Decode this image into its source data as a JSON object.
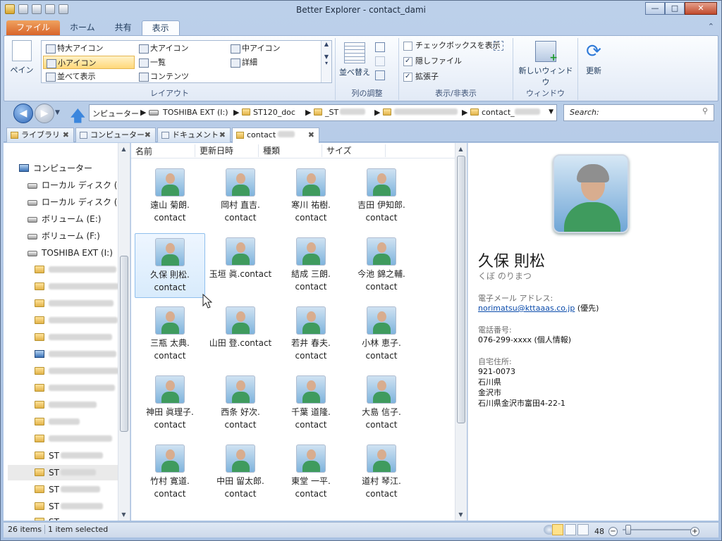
{
  "window": {
    "title": "Better Explorer - contact_dami"
  },
  "ribbon": {
    "tabs": [
      "ファイル",
      "ホーム",
      "共有",
      "表示"
    ],
    "pane_label": "ペイン",
    "layout_items": [
      "特大アイコン",
      "大アイコン",
      "中アイコン",
      "小アイコン",
      "一覧",
      "詳細",
      "並べて表示",
      "コンテンツ"
    ],
    "layout_group": "レイアウト",
    "sort_label": "並べ替え",
    "columns_group": "列の調整",
    "checkbox_label": "チェックボックスを表示",
    "hidden_label": "隠しファイル",
    "ext_label": "拡張子",
    "showhide_group": "表示/非表示",
    "new_window_label": "新しいウィンドウ",
    "window_group": "ウィンドウ",
    "refresh_label": "更新"
  },
  "address": {
    "crumbs": [
      "ンピューター",
      "TOSHIBA EXT (I:)",
      "ST120_doc",
      "_ST",
      "",
      "contact_"
    ],
    "search_placeholder": "Search:"
  },
  "doc_tabs": [
    "ライブラリ",
    "コンピューター",
    "ドキュメント",
    "contact"
  ],
  "nav": {
    "computer": "コンピューター",
    "drives": [
      "ローカル ディスク (",
      "ローカル ディスク (",
      "ボリューム (E:)",
      "ボリューム (F:)",
      "TOSHIBA EXT (I:)"
    ],
    "st_folders": [
      "ST",
      "ST",
      "ST",
      "ST",
      "ST"
    ]
  },
  "columns": [
    "名前",
    "更新日時",
    "種類",
    "サイズ"
  ],
  "files": [
    {
      "line1": "遠山 菊朗.",
      "line2": "contact"
    },
    {
      "line1": "岡村 直吉.",
      "line2": "contact"
    },
    {
      "line1": "寒川 祐樹.",
      "line2": "contact"
    },
    {
      "line1": "吉田 伊知郎.",
      "line2": "contact"
    },
    {
      "line1": "久保 則松.",
      "line2": "contact"
    },
    {
      "line1": "玉垣 眞.contact",
      "line2": ""
    },
    {
      "line1": "結成 三朗.",
      "line2": "contact"
    },
    {
      "line1": "今池 錦之輔.",
      "line2": "contact"
    },
    {
      "line1": "三瓶 太典.",
      "line2": "contact"
    },
    {
      "line1": "山田 登.contact",
      "line2": ""
    },
    {
      "line1": "若井 春夫.",
      "line2": "contact"
    },
    {
      "line1": "小林 恵子.",
      "line2": "contact"
    },
    {
      "line1": "神田 眞理子.",
      "line2": "contact"
    },
    {
      "line1": "西条 好次.",
      "line2": "contact"
    },
    {
      "line1": "千葉 道隆.",
      "line2": "contact"
    },
    {
      "line1": "大島 信子.",
      "line2": "contact"
    },
    {
      "line1": "竹村 寛道.",
      "line2": "contact"
    },
    {
      "line1": "中田 留太郎.",
      "line2": "contact"
    },
    {
      "line1": "東堂 一平.",
      "line2": "contact"
    },
    {
      "line1": "道村 琴江.",
      "line2": "contact"
    }
  ],
  "detail": {
    "name": "久保 則松",
    "kana": "くぼ のりまつ",
    "email_label": "電子メール アドレス:",
    "email": "norimatsu@kttaaas.co.jp",
    "email_note": "(優先)",
    "phone_label": "電話番号:",
    "phone": "076-299-xxxx (個人情報)",
    "address_label": "自宅住所:",
    "postal": "921-0073",
    "pref": "石川県",
    "city": "金沢市",
    "street": "石川県金沢市富田4-22-1"
  },
  "status": {
    "count": "26 items",
    "selected": "1 item selected",
    "zoom": "48"
  }
}
